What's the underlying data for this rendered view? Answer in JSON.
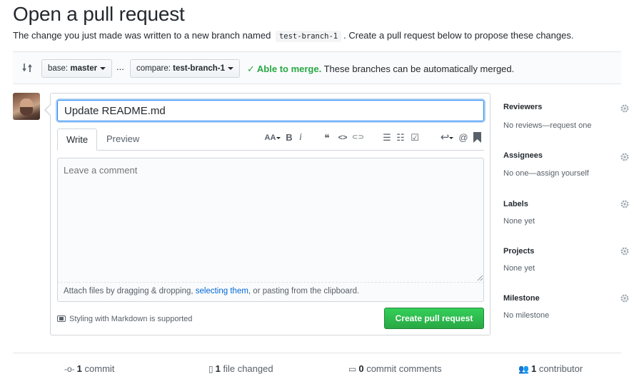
{
  "header": {
    "title": "Open a pull request",
    "subtitle_before": "The change you just made was written to a new branch named",
    "branch_code": "test-branch-1",
    "subtitle_after": ". Create a pull request below to propose these changes."
  },
  "compare": {
    "swap_icon": "git-compare-icon",
    "base_prefix": "base:",
    "base_branch": "master",
    "dots": "...",
    "compare_prefix": "compare:",
    "compare_branch": "test-branch-1",
    "merge_ok": "Able to merge.",
    "merge_detail": "These branches can be automatically merged.",
    "ok_color": "#28a745"
  },
  "form": {
    "title_value": "Update README.md",
    "tabs": [
      "Write",
      "Preview"
    ],
    "toolbar_icons": [
      "text-size-icon",
      "bold-icon",
      "italic-icon",
      "quote-icon",
      "code-icon",
      "link-icon",
      "unordered-list-icon",
      "ordered-list-icon",
      "task-list-icon",
      "reply-icon",
      "mention-icon",
      "bookmark-icon"
    ],
    "toolbar_glyphs": {
      "text_size": "AA",
      "bold": "B",
      "italic": "i",
      "quote": "❝",
      "code": "<>",
      "link": "⊂⊃",
      "ul": "☰",
      "ol": "☷",
      "task": "☑",
      "reply": "↩",
      "mention": "@",
      "bookmark": "▮"
    },
    "comment_placeholder": "Leave a comment",
    "attach_before": "Attach files by dragging & dropping, ",
    "attach_link": "selecting them",
    "attach_after": ", or pasting from the clipboard.",
    "markdown_note": "Styling with Markdown is supported",
    "submit_label": "Create pull request",
    "submit_color": "#28a745"
  },
  "sidebar": {
    "sections": [
      {
        "label": "Reviewers",
        "value": "No reviews—request one"
      },
      {
        "label": "Assignees",
        "value": "No one—assign yourself"
      },
      {
        "label": "Labels",
        "value": "None yet"
      },
      {
        "label": "Projects",
        "value": "None yet"
      },
      {
        "label": "Milestone",
        "value": "No milestone"
      }
    ]
  },
  "stats": {
    "commits_count": "1",
    "commits_label": "commit",
    "files_count": "1",
    "files_label": "file changed",
    "comments_count": "0",
    "comments_label": "commit comments",
    "contributors_count": "1",
    "contributors_label": "contributor"
  }
}
